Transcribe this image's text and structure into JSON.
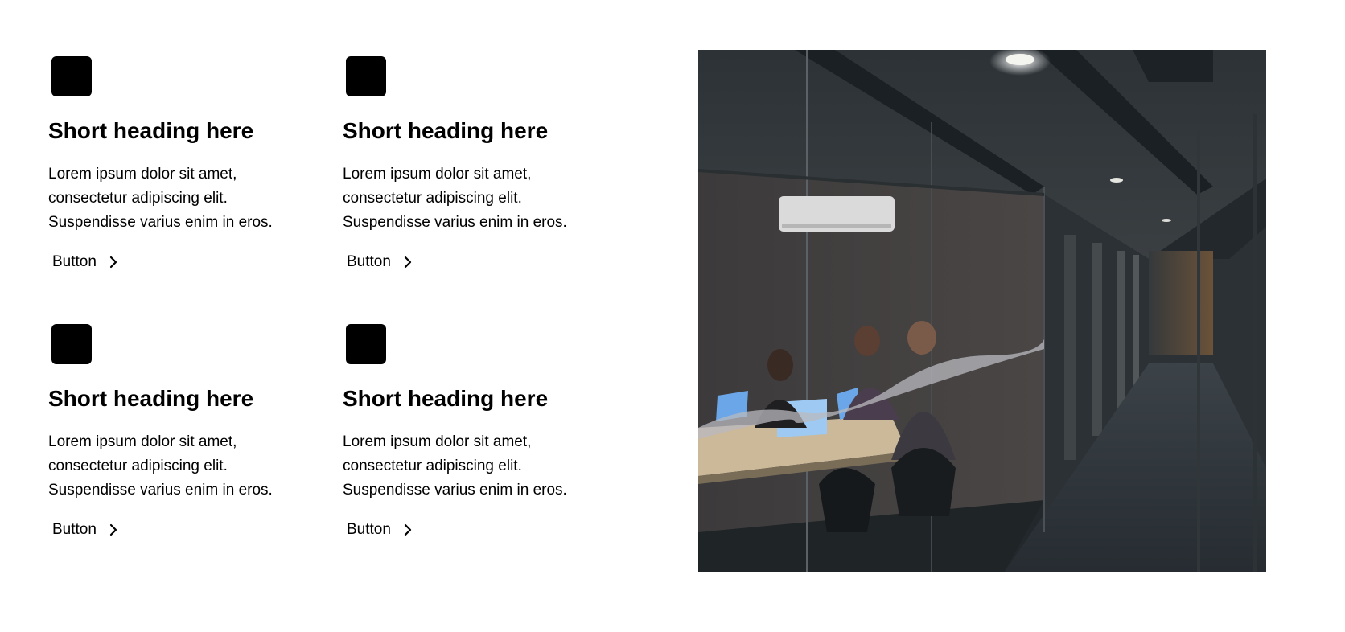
{
  "features": [
    {
      "heading": "Short heading here",
      "text": "Lorem ipsum dolor sit amet, consectetur adipiscing elit. Suspendisse varius enim in eros.",
      "button_label": "Button"
    },
    {
      "heading": "Short heading here",
      "text": "Lorem ipsum dolor sit amet, consectetur adipiscing elit. Suspendisse varius enim in eros.",
      "button_label": "Button"
    },
    {
      "heading": "Short heading here",
      "text": "Lorem ipsum dolor sit amet, consectetur adipiscing elit. Suspendisse varius enim in eros.",
      "button_label": "Button"
    },
    {
      "heading": "Short heading here",
      "text": "Lorem ipsum dolor sit amet, consectetur adipiscing elit. Suspendisse varius enim in eros.",
      "button_label": "Button"
    }
  ],
  "icons": {
    "feature_icon": "placeholder-square-icon",
    "button_icon": "chevron-right-icon"
  },
  "colors": {
    "text": "#000000",
    "background": "#ffffff",
    "icon": "#000000"
  },
  "hero_image": {
    "subject": "office-meeting-room-photo"
  }
}
